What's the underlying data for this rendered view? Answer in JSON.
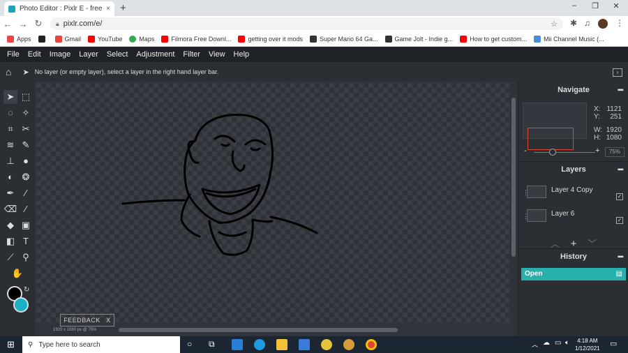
{
  "browser": {
    "tab_title": "Photo Editor : Pixlr E - free image",
    "tab_close": "×",
    "new_tab": "+",
    "window_controls": [
      "–",
      "❐",
      "✕"
    ],
    "url": "pixlr.com/e/",
    "bookmarks": [
      {
        "label": "Apps",
        "color": "#e44"
      },
      {
        "label": "",
        "color": "#222"
      },
      {
        "label": "Gmail",
        "color": "#ea4335"
      },
      {
        "label": "YouTube",
        "color": "#ff0000"
      },
      {
        "label": "Maps",
        "color": "#34a853"
      },
      {
        "label": "Filmora Free Downl...",
        "color": "#ff0000"
      },
      {
        "label": "getting over it mods",
        "color": "#ff0000"
      },
      {
        "label": "Super Mario 64 Ga...",
        "color": "#333"
      },
      {
        "label": "Game Jolt - Indie g...",
        "color": "#333"
      },
      {
        "label": "How to get custom...",
        "color": "#ff0000"
      },
      {
        "label": "Mii Channel Music (...",
        "color": "#4a8fd6"
      }
    ]
  },
  "menu": [
    "File",
    "Edit",
    "Image",
    "Layer",
    "Select",
    "Adjustment",
    "Filter",
    "View",
    "Help"
  ],
  "info_message": "No layer (or empty layer), select a layer in the right hand layer bar.",
  "canvas": {
    "feedback_label": "FEEDBACK",
    "feedback_close": "X",
    "status": "1920 x 1080 px @ 75%"
  },
  "navigate": {
    "title": "Navigate",
    "x_label": "X:",
    "x_value": "1121",
    "y_label": "Y:",
    "y_value": "251",
    "w_label": "W:",
    "w_value": "1920",
    "h_label": "H:",
    "h_value": "1080",
    "zoom": "75%",
    "zoom_minus": "-",
    "zoom_plus": "+"
  },
  "layers": {
    "title": "Layers",
    "items": [
      "Layer 4 Copy",
      "Layer 6"
    ]
  },
  "history": {
    "title": "History",
    "items": [
      "Open"
    ]
  },
  "taskbar": {
    "search_placeholder": "Type here to search",
    "time": "4:18 AM",
    "date": "1/12/2021"
  }
}
